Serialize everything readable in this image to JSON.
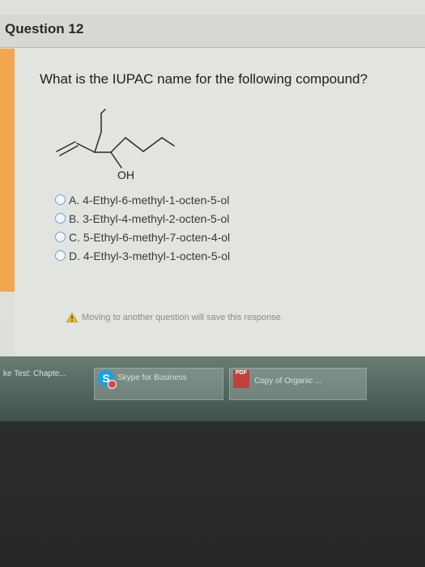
{
  "question": {
    "title": "Question 12",
    "prompt": "What is the IUPAC name for the following compound?",
    "structure_label": "OH"
  },
  "options": [
    {
      "label": "A. 4-Ethyl-6-methyl-1-octen-5-ol"
    },
    {
      "label": "B. 3-Ethyl-4-methyl-2-octen-5-ol"
    },
    {
      "label": "C. 5-Ethyl-6-methyl-7-octen-4-ol"
    },
    {
      "label": "D. 4-Ethyl-3-methyl-1-octen-5-ol"
    }
  ],
  "warning": {
    "icon": "warning-triangle-icon",
    "text": "Moving to another question will save this response."
  },
  "taskbar": {
    "items": [
      {
        "label": "ke Test: Chapte..."
      },
      {
        "label": "Skype for Business",
        "icon": "skype-icon"
      },
      {
        "label": "Copy of Organic ...",
        "icon": "pdf-icon",
        "badge": "PDF"
      }
    ]
  },
  "colors": {
    "accent_strip": "#f3a64f",
    "radio_border": "#5da6e8",
    "taskbar": "#536860"
  }
}
